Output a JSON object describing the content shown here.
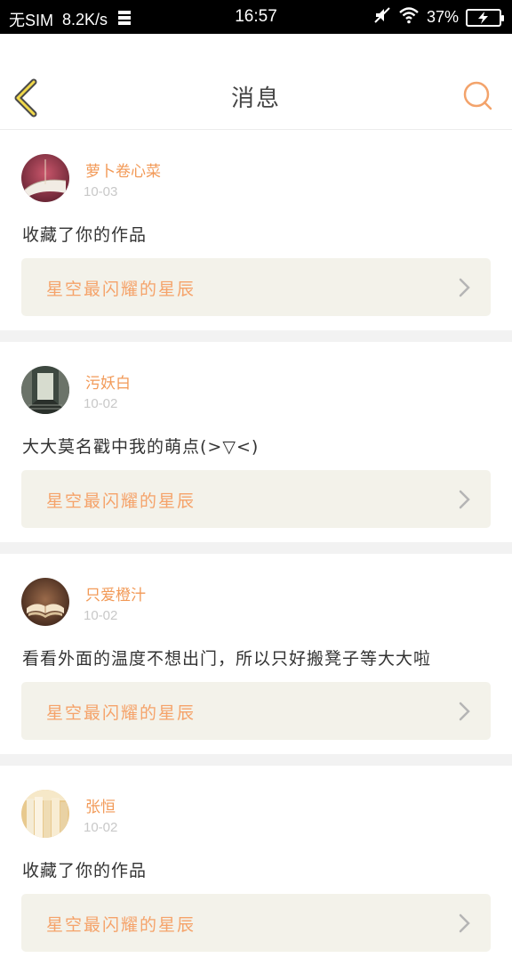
{
  "status_bar": {
    "carrier": "无SIM",
    "speed": "8.2K/s",
    "time": "16:57",
    "battery": "37%"
  },
  "header": {
    "title": "消息"
  },
  "colors": {
    "accent": "#f29a58",
    "card_link_bg": "#f3f2ea",
    "divider": "#f2f2f2"
  },
  "messages": [
    {
      "user": "萝卜卷心菜",
      "date": "10-03",
      "text": "收藏了你的作品",
      "work": "星空最闪耀的星辰",
      "avatar_icon": "book-avatar-icon"
    },
    {
      "user": "污妖白",
      "date": "10-02",
      "text": "大大莫名戳中我的萌点(>▽<)",
      "work": "星空最闪耀的星辰",
      "avatar_icon": "hallway-avatar-icon"
    },
    {
      "user": "只爱橙汁",
      "date": "10-02",
      "text": "看看外面的温度不想出门，所以只好搬凳子等大大啦",
      "work": "星空最闪耀的星辰",
      "avatar_icon": "open-book-avatar-icon"
    },
    {
      "user": "张恒",
      "date": "10-02",
      "text": "收藏了你的作品",
      "work": "星空最闪耀的星辰",
      "avatar_icon": "stacked-books-avatar-icon"
    }
  ]
}
